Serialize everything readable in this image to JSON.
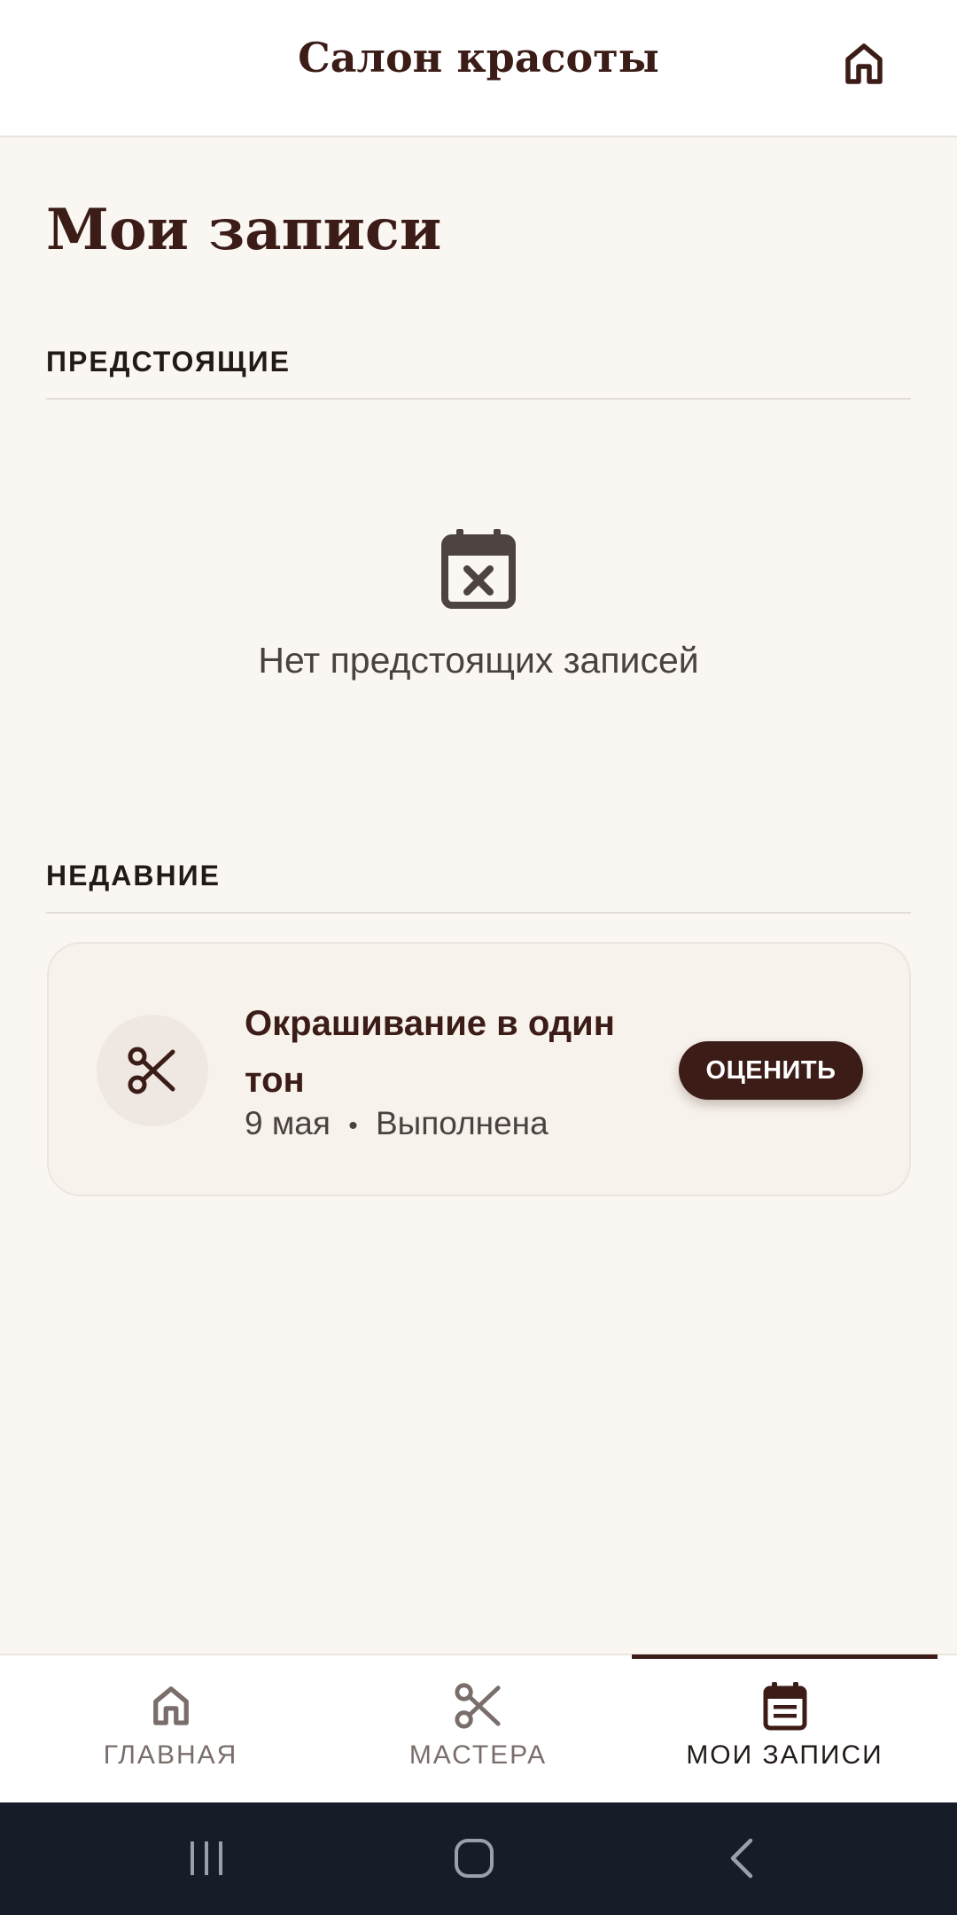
{
  "app_bar": {
    "title": "Салон красоты",
    "action_icon": "home-icon"
  },
  "page": {
    "title": "Мои записи"
  },
  "upcoming": {
    "header": "ПРЕДСТОЯЩИЕ",
    "empty_icon": "calendar-x-icon",
    "empty_text": "Нет предстоящих записей"
  },
  "recent": {
    "header": "НЕДАВНИЕ",
    "items": [
      {
        "icon": "scissors-icon",
        "service": "Окрашивание в один тон",
        "date": "9 мая",
        "separator": "•",
        "status": "Выполнена",
        "action_label": "ОЦЕНИТЬ"
      }
    ]
  },
  "bottom_nav": {
    "items": [
      {
        "label": "ГЛАВНАЯ",
        "icon": "home-icon",
        "active": false
      },
      {
        "label": "МАСТЕРА",
        "icon": "scissors-icon",
        "active": false
      },
      {
        "label": "МОИ ЗАПИСИ",
        "icon": "calendar-icon",
        "active": true
      }
    ]
  },
  "system_nav": {
    "items": [
      "recent-apps-icon",
      "home-button-icon",
      "back-icon"
    ]
  },
  "colors": {
    "primary": "#3b1c17",
    "background": "#faf7f3",
    "card": "#f7f2ec",
    "system_bar": "#161c28"
  }
}
